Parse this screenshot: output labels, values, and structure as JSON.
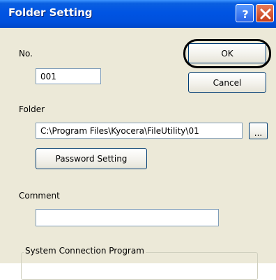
{
  "window": {
    "title": "Folder Setting",
    "help_icon": "question-mark-icon",
    "close_icon": "close-x-icon"
  },
  "fields": {
    "no_label": "No.",
    "no_value": "001",
    "folder_label": "Folder",
    "folder_value": "C:\\Program Files\\Kyocera\\FileUtility\\01",
    "browse_label": "...",
    "password_button": "Password Setting",
    "comment_label": "Comment",
    "comment_value": ""
  },
  "buttons": {
    "ok": "OK",
    "cancel": "Cancel"
  },
  "group": {
    "label": "System Connection Program"
  },
  "colors": {
    "titlebar": "#0054e3",
    "dialog_bg": "#ece9d8",
    "close_button": "#c43d1a",
    "help_button": "#2a64e8"
  }
}
